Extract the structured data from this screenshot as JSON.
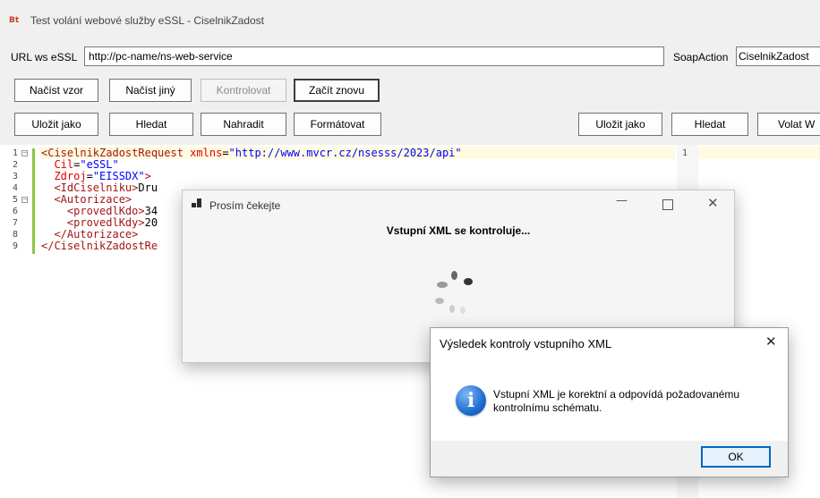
{
  "window": {
    "app_icon_text": "Bt",
    "title": "Test volání webové služby eSSL - CiselnikZadost"
  },
  "url_row": {
    "url_label": "URL ws eSSL",
    "url_value": "http://pc-name/ns-web-service",
    "soap_label": "SoapAction",
    "soap_value": "CiselnikZadost"
  },
  "toolbar1": {
    "load_template": "Načíst vzor",
    "load_other": "Načíst jiný",
    "validate": "Kontrolovat",
    "restart": "Začít znovu"
  },
  "toolbar2": {
    "save_as": "Uložit jako",
    "find": "Hledat",
    "replace": "Nahradit",
    "format": "Formátovat",
    "save_as_right": "Uložit jako",
    "find_right": "Hledat",
    "call_ws": "Volat W"
  },
  "editor": {
    "line_numbers": [
      "1",
      "2",
      "3",
      "4",
      "5",
      "6",
      "7",
      "8",
      "9"
    ],
    "lines": [
      {
        "indent": "",
        "tag": "<CiselnikZadostRequest",
        "attr": " xmlns",
        "eq": "=",
        "val": "\"http://www.mvcr.cz/nsesss/2023/api\"",
        "tail": ""
      },
      {
        "indent": "  ",
        "tag": "",
        "attr": "Cil",
        "eq": "=",
        "val": "\"eSSL\"",
        "tail": ""
      },
      {
        "indent": "  ",
        "tag": "",
        "attr": "Zdroj",
        "eq": "=",
        "val": "\"EISSDX\"",
        "tail": ">"
      },
      {
        "indent": "  ",
        "tag": "<IdCiselniku>",
        "attr": "",
        "eq": "",
        "val": "",
        "tail": "Dru"
      },
      {
        "indent": "  ",
        "tag": "<Autorizace>",
        "attr": "",
        "eq": "",
        "val": "",
        "tail": ""
      },
      {
        "indent": "    ",
        "tag": "<provedlKdo>",
        "attr": "",
        "eq": "",
        "val": "",
        "tail": "34"
      },
      {
        "indent": "    ",
        "tag": "<provedlKdy>",
        "attr": "",
        "eq": "",
        "val": "",
        "tail": "20"
      },
      {
        "indent": "  ",
        "tag": "</Autorizace>",
        "attr": "",
        "eq": "",
        "val": "",
        "tail": ""
      },
      {
        "indent": "",
        "tag": "</CiselnikZadostRe",
        "attr": "",
        "eq": "",
        "val": "",
        "tail": ""
      }
    ],
    "right_line_number": "1"
  },
  "wait_dialog": {
    "title": "Prosím čekejte",
    "message": "Vstupní XML se kontroluje..."
  },
  "result_dialog": {
    "title": "Výsledek kontroly vstupního XML",
    "message_line1": "Vstupní XML je korektní a odpovídá požadovanému",
    "message_line2": "kontrolnímu schématu.",
    "ok": "OK",
    "info_glyph": "i"
  },
  "colors": {
    "tag": "#a31515",
    "attr": "#e00000",
    "value": "#0000ff",
    "info_icon": "#1f6fd1"
  }
}
